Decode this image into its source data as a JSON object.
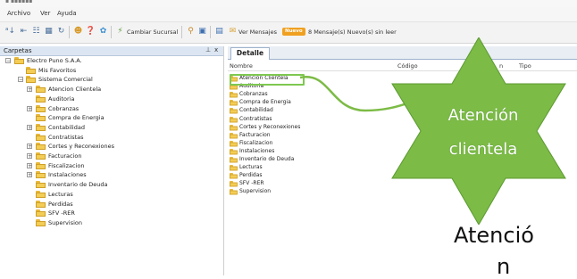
{
  "menubar": {
    "items": [
      "Archivo",
      "Ver",
      "Ayuda"
    ]
  },
  "toolbar": {
    "change_branch_label": "Cambiar Sucursal",
    "view_messages_label": "Ver Mensajes",
    "new_badge": "Nuevo",
    "messages_status": "8 Mensaje(s) Nuevo(s) sin leer"
  },
  "left_panel": {
    "title": "Carpetas",
    "pin": "⊥",
    "close": "x",
    "tree": [
      {
        "label": "Electro Puno S.A.A.",
        "level": 0,
        "expander": "−",
        "icon": "company-icon"
      },
      {
        "label": "Mis Favoritos",
        "level": 1,
        "expander": "",
        "icon": "favorites-icon"
      },
      {
        "label": "Sistema Comercial",
        "level": 1,
        "expander": "−",
        "icon": "folder-icon"
      },
      {
        "label": "Atencion Clientela",
        "level": 2,
        "expander": "+",
        "icon": "folder-icon"
      },
      {
        "label": "Auditoria",
        "level": 2,
        "expander": "",
        "icon": "folder-icon"
      },
      {
        "label": "Cobranzas",
        "level": 2,
        "expander": "+",
        "icon": "folder-icon"
      },
      {
        "label": "Compra de Energia",
        "level": 2,
        "expander": "",
        "icon": "folder-icon"
      },
      {
        "label": "Contabilidad",
        "level": 2,
        "expander": "+",
        "icon": "folder-icon"
      },
      {
        "label": "Contratistas",
        "level": 2,
        "expander": "",
        "icon": "folder-icon"
      },
      {
        "label": "Cortes y Reconexiones",
        "level": 2,
        "expander": "+",
        "icon": "folder-icon"
      },
      {
        "label": "Facturacion",
        "level": 2,
        "expander": "+",
        "icon": "folder-icon"
      },
      {
        "label": "Fiscalizacion",
        "level": 2,
        "expander": "+",
        "icon": "folder-icon"
      },
      {
        "label": "Instalaciones",
        "level": 2,
        "expander": "+",
        "icon": "folder-icon"
      },
      {
        "label": "Inventario de Deuda",
        "level": 2,
        "expander": "",
        "icon": "folder-icon"
      },
      {
        "label": "Lecturas",
        "level": 2,
        "expander": "",
        "icon": "folder-icon"
      },
      {
        "label": "Perdidas",
        "level": 2,
        "expander": "",
        "icon": "folder-icon"
      },
      {
        "label": "SFV -RER",
        "level": 2,
        "expander": "",
        "icon": "folder-icon"
      },
      {
        "label": "Supervision",
        "level": 2,
        "expander": "",
        "icon": "folder-icon"
      }
    ]
  },
  "right_panel": {
    "tab": "Detalle",
    "columns": [
      "Nombre",
      "Código",
      "n",
      "Tipo"
    ],
    "rows": [
      "Atencion Clientela",
      "Auditoria",
      "Cobranzas",
      "Compra de Energia",
      "Contabilidad",
      "Contratistas",
      "Cortes y Reconexiones",
      "Facturacion",
      "Fiscalizacion",
      "Instalaciones",
      "Inventario de Deuda",
      "Lecturas",
      "Perdidas",
      "SFV -RER",
      "Supervision"
    ]
  },
  "annotation": {
    "star_line1": "Atención",
    "star_line2": "clientela",
    "big_line1": "Atenció",
    "big_line2": "n",
    "star_color": "#7cbb45",
    "highlight_color": "#7ec850"
  }
}
